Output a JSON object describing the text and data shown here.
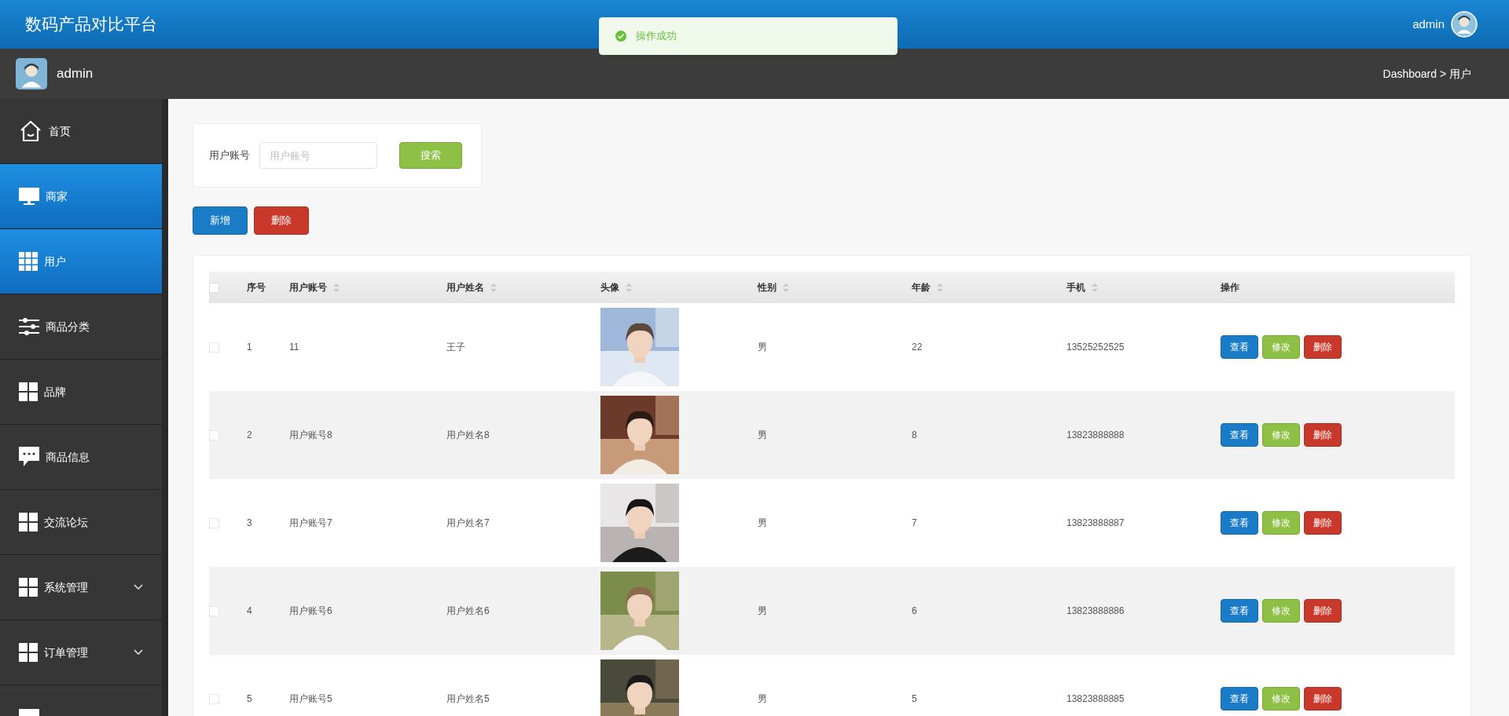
{
  "header": {
    "title": "数码产品对比平台",
    "user": "admin"
  },
  "toast": {
    "message": "操作成功"
  },
  "subbar": {
    "user": "admin",
    "breadcrumb": "Dashboard > 用户"
  },
  "sidebar": {
    "items": [
      {
        "label": "首页",
        "kind": "home",
        "highlighted": false,
        "expandable": false
      },
      {
        "label": "商家",
        "kind": "monitor",
        "highlighted": true,
        "expandable": false
      },
      {
        "label": "用户",
        "kind": "grid9",
        "highlighted": true,
        "expandable": false
      },
      {
        "label": "商品分类",
        "kind": "sliders",
        "highlighted": false,
        "expandable": false
      },
      {
        "label": "品牌",
        "kind": "grid4",
        "highlighted": false,
        "expandable": false
      },
      {
        "label": "商品信息",
        "kind": "chat",
        "highlighted": false,
        "expandable": false
      },
      {
        "label": "交流论坛",
        "kind": "grid4",
        "highlighted": false,
        "expandable": false
      },
      {
        "label": "系统管理",
        "kind": "grid4",
        "highlighted": false,
        "expandable": true
      },
      {
        "label": "订单管理",
        "kind": "grid4",
        "highlighted": false,
        "expandable": true
      },
      {
        "kind": "monitor",
        "highlighted": false,
        "expandable": false
      }
    ]
  },
  "search": {
    "label": "用户账号",
    "placeholder": "用户账号",
    "button": "搜索"
  },
  "actions": [
    {
      "label": "新增",
      "kind": "primary"
    },
    {
      "label": "删除",
      "kind": "danger"
    }
  ],
  "table": {
    "all_checked": false,
    "columns": [
      {
        "label": "序号",
        "sortable": false
      },
      {
        "label": "用户账号",
        "sortable": true
      },
      {
        "label": "用户姓名",
        "sortable": true
      },
      {
        "label": "头像",
        "sortable": true
      },
      {
        "label": "性别",
        "sortable": true
      },
      {
        "label": "年龄",
        "sortable": true
      },
      {
        "label": "手机",
        "sortable": true
      },
      {
        "label": "操作",
        "sortable": false
      }
    ],
    "rows": [
      {
        "checked": false,
        "index": "1",
        "account": "11",
        "name": "王子",
        "gender": "男",
        "age": "22",
        "phone": "13525252525",
        "buttons": [
          {
            "label": "查看",
            "kind": "primary"
          },
          {
            "label": "修改",
            "kind": "success"
          },
          {
            "label": "删除",
            "kind": "danger"
          }
        ]
      },
      {
        "checked": false,
        "index": "2",
        "account": "用户账号8",
        "name": "用户姓名8",
        "gender": "男",
        "age": "8",
        "phone": "13823888888",
        "buttons": [
          {
            "label": "查看",
            "kind": "primary"
          },
          {
            "label": "修改",
            "kind": "success"
          },
          {
            "label": "删除",
            "kind": "danger"
          }
        ]
      },
      {
        "checked": false,
        "index": "3",
        "account": "用户账号7",
        "name": "用户姓名7",
        "gender": "男",
        "age": "7",
        "phone": "13823888887",
        "buttons": [
          {
            "label": "查看",
            "kind": "primary"
          },
          {
            "label": "修改",
            "kind": "success"
          },
          {
            "label": "删除",
            "kind": "danger"
          }
        ]
      },
      {
        "checked": false,
        "index": "4",
        "account": "用户账号6",
        "name": "用户姓名6",
        "gender": "男",
        "age": "6",
        "phone": "13823888886",
        "buttons": [
          {
            "label": "查看",
            "kind": "primary"
          },
          {
            "label": "修改",
            "kind": "success"
          },
          {
            "label": "删除",
            "kind": "danger"
          }
        ]
      },
      {
        "checked": false,
        "index": "5",
        "account": "用户账号5",
        "name": "用户姓名5",
        "gender": "男",
        "age": "5",
        "phone": "13823888885",
        "buttons": [
          {
            "label": "查看",
            "kind": "primary"
          },
          {
            "label": "修改",
            "kind": "success"
          },
          {
            "label": "删除",
            "kind": "danger"
          }
        ]
      }
    ]
  }
}
